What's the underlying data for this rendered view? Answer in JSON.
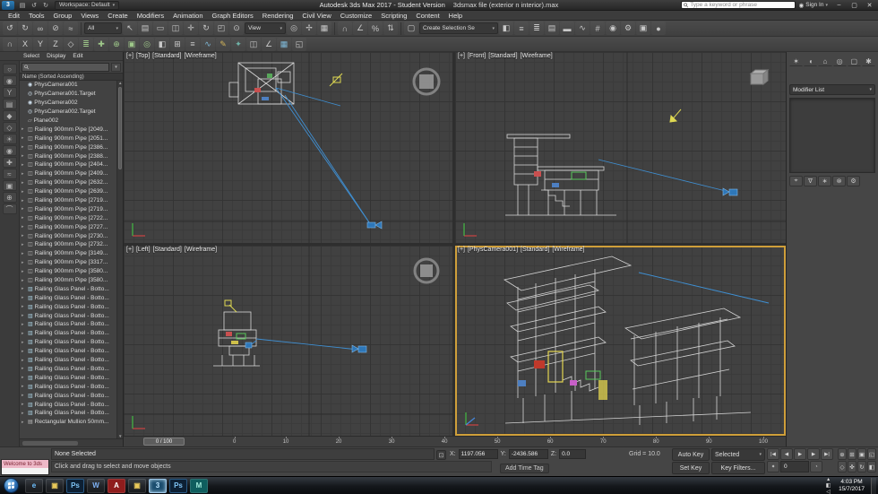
{
  "titlebar": {
    "logo": "3",
    "qat": [
      {
        "n": "save-icon",
        "g": "▤"
      },
      {
        "n": "undo-icon",
        "g": "↺"
      },
      {
        "n": "redo-icon",
        "g": "↻"
      }
    ],
    "workspace": "Workspace: Default",
    "title_app": "Autodesk 3ds Max 2017 - Student Version",
    "title_file": "3dsmax file (exterior n interior).max",
    "search_placeholder": "Type a keyword or phrase",
    "signin": "Sign In",
    "win_buttons": [
      {
        "n": "minimize-button",
        "g": "–"
      },
      {
        "n": "maximize-button",
        "g": "▢"
      },
      {
        "n": "close-button",
        "g": "✕"
      }
    ]
  },
  "menubar": {
    "items": [
      "Edit",
      "Tools",
      "Group",
      "Views",
      "Create",
      "Modifiers",
      "Animation",
      "Graph Editors",
      "Rendering",
      "Civil View",
      "Customize",
      "Scripting",
      "Content",
      "Help"
    ]
  },
  "toolbar_main": {
    "seg1": [
      {
        "n": "undo-scene-icon",
        "g": "↺"
      },
      {
        "n": "redo-scene-icon",
        "g": "↻"
      },
      {
        "n": "select-and-link-icon",
        "g": "∞"
      },
      {
        "n": "unlink-selection-icon",
        "g": "⊘"
      },
      {
        "n": "bind-to-space-warp-icon",
        "g": "≈"
      }
    ],
    "filter_dropdown": "All",
    "seg2": [
      {
        "n": "select-object-icon",
        "g": "↖"
      },
      {
        "n": "select-by-name-icon",
        "g": "▤"
      },
      {
        "n": "rectangular-selection-region-icon",
        "g": "▭"
      },
      {
        "n": "window-crossing-icon",
        "g": "◫"
      },
      {
        "n": "select-and-move-icon",
        "g": "✛"
      },
      {
        "n": "select-and-rotate-icon",
        "g": "↻"
      },
      {
        "n": "select-and-scale-icon",
        "g": "◰"
      },
      {
        "n": "select-and-place-icon",
        "g": "⊙"
      }
    ],
    "coord_dropdown": "View",
    "seg3": [
      {
        "n": "use-pivot-point-center-icon",
        "g": "◎"
      },
      {
        "n": "select-and-manipulate-icon",
        "g": "✢"
      },
      {
        "n": "keyboard-shortcut-override-icon",
        "g": "▦"
      }
    ],
    "seg4": [
      {
        "n": "snap-toggle-icon",
        "g": "∩"
      },
      {
        "n": "angle-snap-toggle-icon",
        "g": "∠"
      },
      {
        "n": "percent-snap-toggle-icon",
        "g": "%"
      },
      {
        "n": "spinner-snap-toggle-icon",
        "g": "⇅"
      }
    ],
    "seg5": [
      {
        "n": "edit-named-selection-sets-icon",
        "g": "▢"
      }
    ],
    "sets_dropdown": "Create Selection Se",
    "seg6": [
      {
        "n": "mirror-icon",
        "g": "◧"
      },
      {
        "n": "align-icon",
        "g": "≡"
      },
      {
        "n": "toggle-scene-explorer-icon",
        "g": "≣"
      },
      {
        "n": "toggle-layer-explorer-icon",
        "g": "▤"
      },
      {
        "n": "toggle-ribbon-icon",
        "g": "▬"
      },
      {
        "n": "curve-editor-icon",
        "g": "∿"
      },
      {
        "n": "schematic-view-icon",
        "g": "#"
      },
      {
        "n": "material-editor-icon",
        "g": "◉"
      },
      {
        "n": "render-setup-icon",
        "g": "⚙"
      },
      {
        "n": "rendered-frame-window-icon",
        "g": "▣"
      },
      {
        "n": "render-production-icon",
        "g": "●"
      }
    ]
  },
  "toolbar_second": {
    "icons": [
      {
        "n": "snaps-toolbar-icon",
        "g": "∩",
        "s": "color:#c8c8c8"
      },
      {
        "n": "constraint-x-icon",
        "g": "X",
        "s": "color:#d0d0d0"
      },
      {
        "n": "constraint-y-icon",
        "g": "Y",
        "s": "color:#d0d0d0"
      },
      {
        "n": "constraint-z-icon",
        "g": "Z",
        "s": "color:#d0d0d0"
      },
      {
        "n": "constraint-plane-icon",
        "g": "◇",
        "s": "color:#d0d0d0"
      },
      {
        "n": "layer-manager-icon",
        "g": "≣",
        "s": "color:#9fc98a"
      },
      {
        "n": "create-new-layer-icon",
        "g": "✚",
        "s": "color:#9fc98a"
      },
      {
        "n": "add-selection-to-layer-icon",
        "g": "⊕",
        "s": "color:#9fc98a"
      },
      {
        "n": "select-objects-in-layer-icon",
        "g": "▣",
        "s": "color:#9fc98a"
      },
      {
        "n": "set-current-layer-icon",
        "g": "◎",
        "s": "color:#9fc98a"
      },
      {
        "n": "mirror-tool-icon",
        "g": "◧",
        "s": "color:#c8c8c8"
      },
      {
        "n": "array-tool-icon",
        "g": "⊞",
        "s": "color:#c8c8c8"
      },
      {
        "n": "align-tool-icon",
        "g": "≡",
        "s": "color:#c8c8c8"
      },
      {
        "n": "curve-tool-icon",
        "g": "∿",
        "s": "color:#7fb9d8"
      },
      {
        "n": "paint-tool-icon",
        "g": "✎",
        "s": "color:#d2b45a"
      },
      {
        "n": "populate-tool-icon",
        "g": "✦",
        "s": "color:#6fb3a8"
      },
      {
        "n": "snapshot-tool-icon",
        "g": "◫",
        "s": "color:#c8c8c8"
      },
      {
        "n": "measure-tool-icon",
        "g": "∠",
        "s": "color:#c8c8c8"
      },
      {
        "n": "display-toggle-icon",
        "g": "▦",
        "s": "color:#7fb9d8"
      },
      {
        "n": "isolate-selection-icon",
        "g": "◱",
        "s": "color:#c8c8c8"
      }
    ]
  },
  "scene_explorer": {
    "menu": [
      "Select",
      "Display",
      "Edit"
    ],
    "header": "Name (Sorted Ascending)",
    "left_tools": [
      {
        "n": "display-none-icon",
        "g": "○"
      },
      {
        "n": "display-influences-icon",
        "g": "◉"
      },
      {
        "n": "sort-by-hierarchy-icon",
        "g": "Y"
      },
      {
        "n": "sort-by-layer-icon",
        "g": "▤"
      },
      {
        "n": "filter-geometry-icon",
        "g": "◆"
      },
      {
        "n": "filter-shapes-icon",
        "g": "◇"
      },
      {
        "n": "filter-lights-icon",
        "g": "☀"
      },
      {
        "n": "filter-cameras-icon",
        "g": "◉"
      },
      {
        "n": "filter-helpers-icon",
        "g": "✚"
      },
      {
        "n": "filter-spacewarps-icon",
        "g": "≈"
      },
      {
        "n": "filter-groups-icon",
        "g": "▣"
      },
      {
        "n": "filter-xrefs-icon",
        "g": "⊕"
      },
      {
        "n": "filter-bones-icon",
        "g": "⌒"
      }
    ],
    "rows": [
      {
        "a": "",
        "g": "◉",
        "s": "color:#cfe0ee",
        "t": "PhysCamera001"
      },
      {
        "a": "",
        "g": "◎",
        "s": "color:#cfe0ee",
        "t": "PhysCamera001.Target"
      },
      {
        "a": "",
        "g": "◉",
        "s": "color:#cfe0ee",
        "t": "PhysCamera002"
      },
      {
        "a": "",
        "g": "◎",
        "s": "color:#cfe0ee",
        "t": "PhysCamera002.Target"
      },
      {
        "a": "",
        "g": "▱",
        "s": "color:#b9b9b9",
        "t": "Plane002"
      },
      {
        "a": "▸",
        "g": "◫",
        "s": "color:#bdbdbd",
        "t": "Railing 900mm Pipe [2049..."
      },
      {
        "a": "▸",
        "g": "◫",
        "s": "color:#bdbdbd",
        "t": "Railing 900mm Pipe [2051..."
      },
      {
        "a": "▸",
        "g": "◫",
        "s": "color:#bdbdbd",
        "t": "Railing 900mm Pipe [2386..."
      },
      {
        "a": "▸",
        "g": "◫",
        "s": "color:#bdbdbd",
        "t": "Railing 900mm Pipe [2388..."
      },
      {
        "a": "▸",
        "g": "◫",
        "s": "color:#bdbdbd",
        "t": "Railing 900mm Pipe [2404..."
      },
      {
        "a": "▸",
        "g": "◫",
        "s": "color:#bdbdbd",
        "t": "Railing 900mm Pipe [2409..."
      },
      {
        "a": "▸",
        "g": "◫",
        "s": "color:#bdbdbd",
        "t": "Railing 900mm Pipe [2632..."
      },
      {
        "a": "▸",
        "g": "◫",
        "s": "color:#bdbdbd",
        "t": "Railing 900mm Pipe [2639..."
      },
      {
        "a": "▸",
        "g": "◫",
        "s": "color:#bdbdbd",
        "t": "Railing 900mm Pipe [2719..."
      },
      {
        "a": "▸",
        "g": "◫",
        "s": "color:#bdbdbd",
        "t": "Railing 900mm Pipe [2719..."
      },
      {
        "a": "▸",
        "g": "◫",
        "s": "color:#bdbdbd",
        "t": "Railing 900mm Pipe [2722..."
      },
      {
        "a": "▸",
        "g": "◫",
        "s": "color:#bdbdbd",
        "t": "Railing 900mm Pipe [2727..."
      },
      {
        "a": "▸",
        "g": "◫",
        "s": "color:#bdbdbd",
        "t": "Railing 900mm Pipe [2730..."
      },
      {
        "a": "▸",
        "g": "◫",
        "s": "color:#bdbdbd",
        "t": "Railing 900mm Pipe [2732..."
      },
      {
        "a": "▸",
        "g": "◫",
        "s": "color:#bdbdbd",
        "t": "Railing 900mm Pipe [3149..."
      },
      {
        "a": "▸",
        "g": "◫",
        "s": "color:#bdbdbd",
        "t": "Railing 900mm Pipe [3317..."
      },
      {
        "a": "▸",
        "g": "◫",
        "s": "color:#bdbdbd",
        "t": "Railing 900mm Pipe [3580..."
      },
      {
        "a": "▸",
        "g": "◫",
        "s": "color:#bdbdbd",
        "t": "Railing 900mm Pipe [3580..."
      },
      {
        "a": "▸",
        "g": "▥",
        "s": "color:#a8cede",
        "t": "Railing Glass Panel - Botto..."
      },
      {
        "a": "▸",
        "g": "▥",
        "s": "color:#a8cede",
        "t": "Railing Glass Panel - Botto..."
      },
      {
        "a": "▸",
        "g": "▥",
        "s": "color:#a8cede",
        "t": "Railing Glass Panel - Botto..."
      },
      {
        "a": "▸",
        "g": "▥",
        "s": "color:#a8cede",
        "t": "Railing Glass Panel - Botto..."
      },
      {
        "a": "▸",
        "g": "▥",
        "s": "color:#a8cede",
        "t": "Railing Glass Panel - Botto..."
      },
      {
        "a": "▸",
        "g": "▥",
        "s": "color:#a8cede",
        "t": "Railing Glass Panel - Botto..."
      },
      {
        "a": "▸",
        "g": "▥",
        "s": "color:#a8cede",
        "t": "Railing Glass Panel - Botto..."
      },
      {
        "a": "▸",
        "g": "▥",
        "s": "color:#a8cede",
        "t": "Railing Glass Panel - Botto..."
      },
      {
        "a": "▸",
        "g": "▥",
        "s": "color:#a8cede",
        "t": "Railing Glass Panel - Botto..."
      },
      {
        "a": "▸",
        "g": "▥",
        "s": "color:#a8cede",
        "t": "Railing Glass Panel - Botto..."
      },
      {
        "a": "▸",
        "g": "▥",
        "s": "color:#a8cede",
        "t": "Railing Glass Panel - Botto..."
      },
      {
        "a": "▸",
        "g": "▥",
        "s": "color:#a8cede",
        "t": "Railing Glass Panel - Botto..."
      },
      {
        "a": "▸",
        "g": "▥",
        "s": "color:#a8cede",
        "t": "Railing Glass Panel - Botto..."
      },
      {
        "a": "▸",
        "g": "▥",
        "s": "color:#a8cede",
        "t": "Railing Glass Panel - Botto..."
      },
      {
        "a": "▸",
        "g": "▥",
        "s": "color:#a8cede",
        "t": "Railing Glass Panel - Botto..."
      },
      {
        "a": "▸",
        "g": "▤",
        "s": "color:#bdbdbd",
        "t": "Rectangular Mullion 50mm..."
      }
    ]
  },
  "viewports": {
    "top": {
      "menu": "[+]",
      "name": "[Top]",
      "style": "[Standard]",
      "shading": "[Wireframe]"
    },
    "front": {
      "menu": "[+]",
      "name": "[Front]",
      "style": "[Standard]",
      "shading": "[Wireframe]"
    },
    "left": {
      "menu": "[+]",
      "name": "[Left]",
      "style": "[Standard]",
      "shading": "[Wireframe]"
    },
    "camera": {
      "menu": "[+]",
      "name": "[PhysCamera001]",
      "style": "[Standard]",
      "shading": "[Wireframe]"
    }
  },
  "command_panel": {
    "tabs": [
      {
        "n": "create-tab",
        "g": "✶"
      },
      {
        "n": "modify-tab",
        "g": "◖"
      },
      {
        "n": "hierarchy-tab",
        "g": "⌂"
      },
      {
        "n": "motion-tab",
        "g": "◎"
      },
      {
        "n": "display-tab",
        "g": "▢"
      },
      {
        "n": "utilities-tab",
        "g": "✱"
      }
    ],
    "modifier_list_label": "Modifier List",
    "stack_buttons": [
      {
        "n": "pin-stack-icon",
        "g": "⌖"
      },
      {
        "n": "show-end-result-icon",
        "g": "∇"
      },
      {
        "n": "make-unique-icon",
        "g": "∗"
      },
      {
        "n": "remove-modifier-icon",
        "g": "⊗"
      },
      {
        "n": "configure-modifier-sets-icon",
        "g": "⚙"
      }
    ]
  },
  "timeline": {
    "slider_label": "0 / 100",
    "ticks": [
      "0",
      "10",
      "20",
      "30",
      "40",
      "50",
      "60",
      "70",
      "80",
      "90",
      "100"
    ]
  },
  "statusbar": {
    "listener_line": "Welcome to 3ds",
    "status": "None Selected",
    "prompt": "Click and drag to select and move objects",
    "lock_glyph": "⊡",
    "x_label": "X:",
    "x_value": "1197.056",
    "y_label": "Y:",
    "y_value": "-2436.586",
    "z_label": "Z:",
    "z_value": "0.0",
    "grid": "Grid = 10.0",
    "add_time_tag": "Add Time Tag",
    "auto_key": "Auto Key",
    "set_key": "Set Key",
    "selected": "Selected",
    "key_filters": "Key Filters...",
    "transport_row1": [
      {
        "n": "go-to-start-button",
        "g": "|◀"
      },
      {
        "n": "previous-frame-button",
        "g": "◀"
      },
      {
        "n": "play-animation-button",
        "g": "▶"
      },
      {
        "n": "next-frame-button",
        "g": "▶"
      },
      {
        "n": "go-to-end-button",
        "g": "▶|"
      }
    ],
    "key_mode_glyph": "✦",
    "frame_value": "0",
    "time_config_glyph": "◔",
    "nav_icons": [
      {
        "n": "zoom-icon",
        "g": "⊕"
      },
      {
        "n": "zoom-all-icon",
        "g": "⊞"
      },
      {
        "n": "zoom-extents-icon",
        "g": "▣"
      },
      {
        "n": "zoom-extents-all-icon",
        "g": "◱"
      },
      {
        "n": "field-of-view-icon",
        "g": "◇"
      },
      {
        "n": "pan-view-icon",
        "g": "✜"
      },
      {
        "n": "orbit-icon",
        "g": "↻"
      },
      {
        "n": "maximize-viewport-toggle-icon",
        "g": "◧"
      }
    ]
  },
  "taskbar": {
    "items": [
      {
        "n": "taskbar-internet-explorer",
        "label": "e",
        "cls": "titem",
        "style": "color:#6fc0ff"
      },
      {
        "n": "taskbar-file-explorer",
        "label": "▣",
        "cls": "titem",
        "style": "color:#e8c95a"
      },
      {
        "n": "taskbar-photoshop",
        "label": "Ps",
        "cls": "titem",
        "style": "background:#0d2034;color:#7fc4f5;border-color:#2a5a85"
      },
      {
        "n": "taskbar-word",
        "label": "W",
        "cls": "titem",
        "style": "color:#7fb2f5"
      },
      {
        "n": "taskbar-acrobat",
        "label": "A",
        "cls": "titem",
        "style": "background:#8f1d1d;color:#ffffff"
      },
      {
        "n": "taskbar-folder",
        "label": "▣",
        "cls": "titem",
        "style": "color:#e8c95a"
      },
      {
        "n": "taskbar-3ds-max",
        "label": "3",
        "cls": "titem active",
        "style": "background:#1b4d6e;color:#bfe6ff"
      },
      {
        "n": "taskbar-photoshop-2",
        "label": "Ps",
        "cls": "titem",
        "style": "background:#0d2034;color:#7fc4f5;border-color:#2a5a85"
      },
      {
        "n": "taskbar-max-document",
        "label": "M",
        "cls": "titem",
        "style": "background:#0f5e5e;color:#9fe8d8"
      }
    ],
    "tray": [
      {
        "n": "hidden-icons-icon",
        "g": "▴"
      },
      {
        "n": "network-icon",
        "g": "◧"
      },
      {
        "n": "volume-icon",
        "g": "◁"
      }
    ],
    "time": "4:03 PM",
    "date": "15/7/2017"
  }
}
